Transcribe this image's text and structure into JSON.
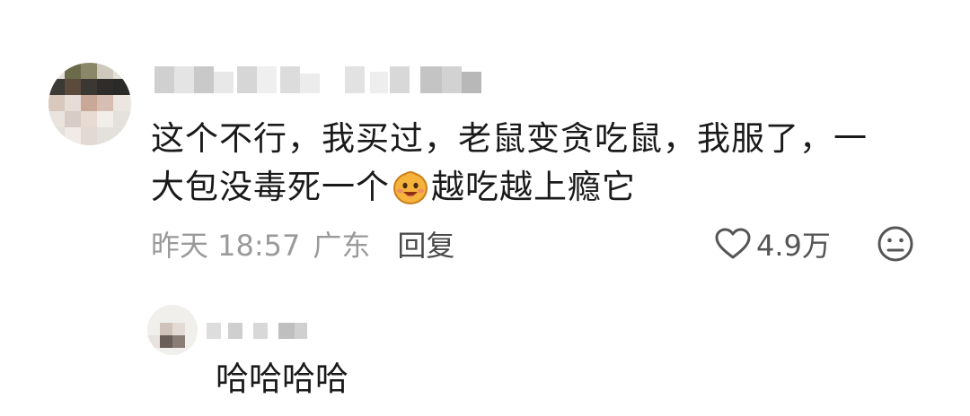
{
  "comment": {
    "text_line1": "这个不行，我买过，老鼠变贪吃鼠，我服了，一",
    "text_line2_before": "大包没毒死一个",
    "emoji_icon": "grinning-face-icon",
    "text_line2_after": "越吃越上瘾它",
    "time": "昨天 18:57",
    "region": "广东",
    "reply_label": "回复",
    "like_count": "4.9万"
  },
  "sub_reply": {
    "text": "哈哈哈哈"
  },
  "colors": {
    "text": "#1a1a1a",
    "meta": "#9a9a9a",
    "accent_emoji": "#f4b23a"
  }
}
